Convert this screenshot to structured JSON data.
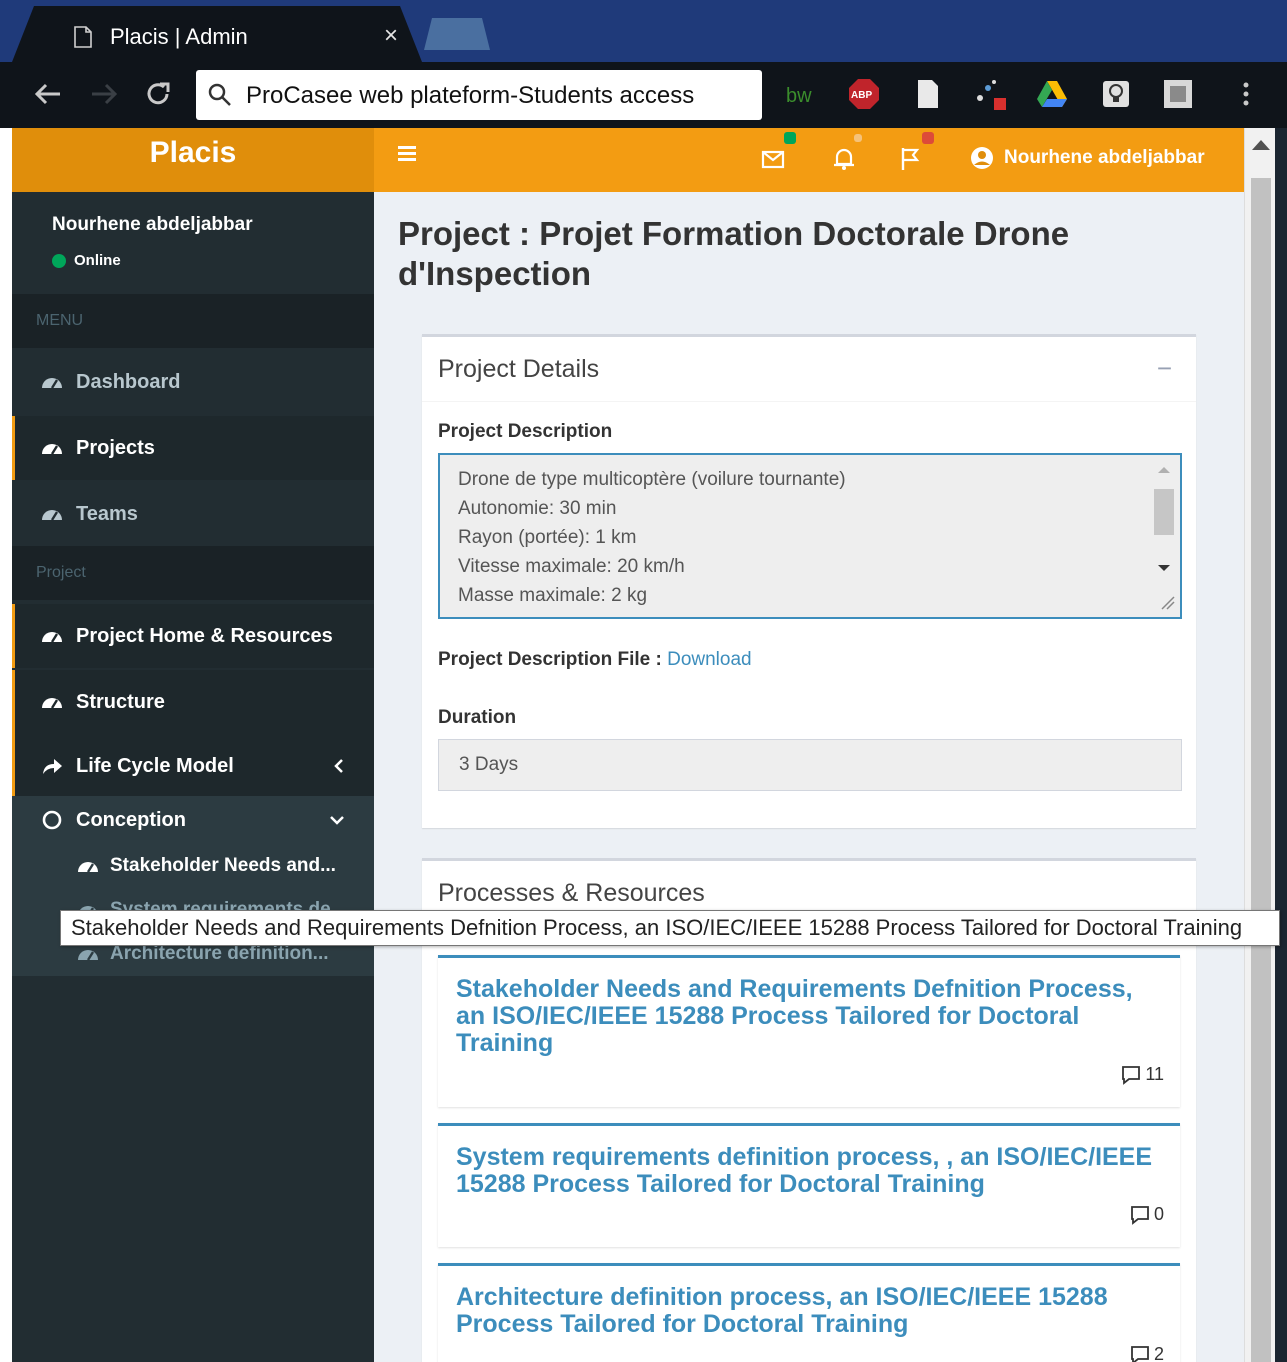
{
  "browser": {
    "tab_title": "Placis | Admin",
    "tab_close": "×",
    "omnibox_text": "ProCasee web plateform-Students access"
  },
  "header": {
    "logo": "Placis",
    "user_name": "Nourhene abdeljabbar",
    "accent_color": "#f39c12"
  },
  "sidebar": {
    "user_name": "Nourhene abdeljabbar",
    "status": "Online",
    "menu_header": "MENU",
    "menu_items": [
      {
        "label": "Dashboard",
        "icon": "dashboard-icon"
      },
      {
        "label": "Projects",
        "icon": "dashboard-icon"
      },
      {
        "label": "Teams",
        "icon": "dashboard-icon"
      }
    ],
    "project_header": "Project",
    "project_items": [
      {
        "label": "Project Home & Resources",
        "icon": "dashboard-icon"
      },
      {
        "label": "Structure",
        "icon": "dashboard-icon"
      },
      {
        "label": "Life Cycle Model",
        "icon": "share-arrow-icon"
      }
    ],
    "conception": "Conception",
    "sub_items": [
      "Stakeholder Needs and...",
      "System requirements de...",
      "Architecture definition..."
    ]
  },
  "main": {
    "page_title": "Project : Projet Formation Doctorale Drone d'Inspection",
    "details": {
      "title": "Project Details",
      "collapse": "−",
      "desc_label": "Project Description",
      "desc_lines": [
        "Drone de type multicoptère (voilure tournante)",
        "Autonomie: 30 min",
        "Rayon (portée): 1 km",
        "Vitesse maximale: 20 km/h",
        "Masse maximale: 2 kg"
      ],
      "file_label": "Project Description File :",
      "file_link": "Download",
      "duration_label": "Duration",
      "duration_value": "3 Days"
    },
    "processes": {
      "title": "Processes & Resources",
      "items": [
        {
          "title": "Stakeholder Needs and Requirements Defnition Process, an ISO/IEC/IEEE 15288 Process Tailored for Doctoral Training",
          "count": "11"
        },
        {
          "title": "System requirements definition process, , an ISO/IEC/IEEE 15288 Process Tailored for Doctoral Training",
          "count": "0"
        },
        {
          "title": "Architecture definition process, an ISO/IEC/IEEE 15288 Process Tailored for Doctoral Training",
          "count": "2"
        }
      ]
    }
  },
  "tooltip": "Stakeholder Needs and Requirements Defnition Process, an ISO/IEC/IEEE 15288 Process Tailored for Doctoral Training"
}
